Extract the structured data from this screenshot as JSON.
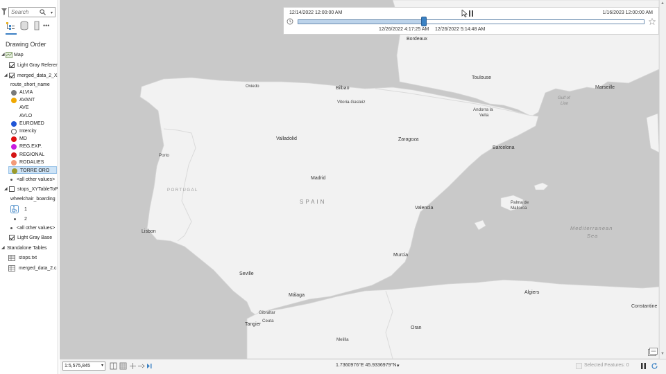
{
  "contents": {
    "search_placeholder": "Search",
    "drawing_order_title": "Drawing Order",
    "map_label": "Map",
    "layers": [
      {
        "label": "Light Gray Referen",
        "checked": true
      },
      {
        "label": "merged_data_2_X",
        "checked": true
      },
      {
        "label": "stops_XYTableToP",
        "checked": false
      },
      {
        "label": "Light Gray Base",
        "checked": true
      }
    ],
    "field_name": "route_short_name",
    "symbols": [
      {
        "label": "ALVIA",
        "color": "#7a7a7a"
      },
      {
        "label": "AVANT",
        "color": "#f0a800"
      },
      {
        "label": "AVE",
        "color": ""
      },
      {
        "label": "AVLO",
        "color": ""
      },
      {
        "label": "EUROMED",
        "color": "#1f55d6"
      },
      {
        "label": "Intercity",
        "color": "#ffffff"
      },
      {
        "label": "MD",
        "color": "#e01010"
      },
      {
        "label": "REG.EXP.",
        "color": "#c81ee0"
      },
      {
        "label": "REGIONAL",
        "color": "#d41515"
      },
      {
        "label": "RODALIES",
        "color": "#f29b7a"
      },
      {
        "label": "TORRE ORO",
        "color": "#9a9a2a"
      }
    ],
    "all_other_values_1": "<all other values>",
    "wheelchair_field": "wheelchair_boarding",
    "wheelchair_values": [
      "1",
      "2"
    ],
    "all_other_values_2": "<all other values>",
    "standalone_tables_label": "Standalone Tables",
    "tables": [
      "stops.txt",
      "merged_data_2.c"
    ]
  },
  "time_slider": {
    "start_label": "12/14/2022 12:00:00 AM",
    "end_label": "1/16/2023 12:00:00 AM",
    "current_start": "12/26/2022 4:17:25 AM",
    "current_end": "12/26/2022 5:14:48 AM",
    "current_position_fraction": 0.364
  },
  "map": {
    "country_labels": {
      "spain": "SPAIN",
      "portugal": "PORTUGAL"
    },
    "water_labels": {
      "gulf": "Gulf of",
      "gulf2": "Lion",
      "med": "Mediterranean",
      "med2": "Sea"
    },
    "cities": [
      "Bordeaux",
      "Toulouse",
      "Marseille",
      "Oviedo",
      "Bilbao",
      "Vitoria-Gasteiz",
      "Andorra la",
      "Vella",
      "Valladolid",
      "Zaragoza",
      "Barcelona",
      "Porto",
      "Madrid",
      "Valencia",
      "Palma de",
      "Mallorca",
      "Lisbon",
      "Murcia",
      "Seville",
      "Málaga",
      "Algiers",
      "Gibraltar",
      "Ceuta",
      "Tangier",
      "Oran",
      "Melilla",
      "Constantine"
    ]
  },
  "status_bar": {
    "scale": "1:5,575,845",
    "coordinates": "1.7360976°E 45.9336979°N",
    "selected_features": "Selected Features: 0"
  },
  "colors": {
    "water": "#c9c9c9",
    "land": "#f2f2f2",
    "accent": "#3b82c4"
  }
}
